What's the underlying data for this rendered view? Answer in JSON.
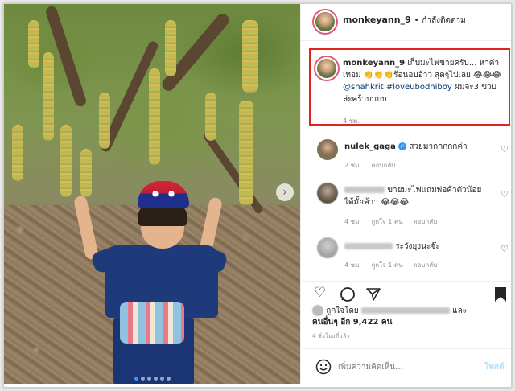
{
  "post": {
    "username": "monkeyann_9",
    "separator": "•",
    "follow_status": "กำลังติดตาม"
  },
  "caption": {
    "username": "monkeyann_9",
    "text_part1": "เก็บมะไฟขายครับ... หาค่าเทอม 👏👏👏ร้อนอบอ้าว สุดๆไปเลย 😂😂😂",
    "tag1": "@shahkrit",
    "tag2": "#loveubodhiboy",
    "text_part2": "ผมจะ3 ขวบล่ะคร้าบบบบ",
    "time": "4 ชม."
  },
  "comments": [
    {
      "username": "nulek_gaga",
      "text": "สวยมากกกกกค่า",
      "time": "2 ชม.",
      "reply_label": "ตอบกลับ",
      "likes_label": ""
    },
    {
      "username": "",
      "text": "ขายมะไฟแถมพ่อค้าตัวน้อยได้มั้ยค้าา 😂😂😂",
      "time": "4 ชม.",
      "likes_label": "ถูกใจ 1 คน",
      "reply_label": "ตอบกลับ"
    },
    {
      "username": "",
      "text": "ระวังยุงนะจ๊ะ",
      "time": "4 ชม.",
      "likes_label": "ถูกใจ 1 คน",
      "reply_label": "ตอบกลับ"
    }
  ],
  "likes": {
    "prefix": "ถูกใจโดย",
    "connector": "และ",
    "others": "คนอื่นๆ อีก 9,422 คน"
  },
  "post_age": "4 ชั่วโมงที่แล้ว",
  "comment_input": {
    "placeholder": "เพิ่มความคิดเห็น..."
  },
  "post_button": "โพสต์",
  "icons": {
    "heart": "heart-icon",
    "comment": "comment-icon",
    "share": "share-icon",
    "bookmark": "bookmark-icon",
    "emoji": "emoji-icon",
    "carousel_next": "chevron-right-icon"
  },
  "colors": {
    "highlight_box": "#e2231a",
    "link": "#00376b",
    "verified": "#3897f0",
    "post_button": "#b2dffc"
  },
  "carousel": {
    "count": 6,
    "active": 0
  }
}
